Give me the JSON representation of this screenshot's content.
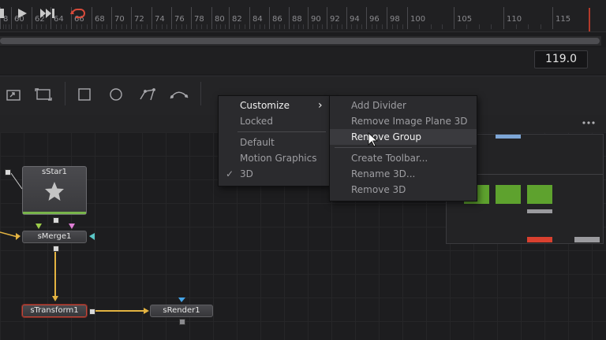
{
  "ruler": {
    "ticks": [
      "8",
      "60",
      "62",
      "64",
      "66",
      "68",
      "70",
      "72",
      "74",
      "76",
      "78",
      "80",
      "82",
      "84",
      "86",
      "88",
      "90",
      "92",
      "94",
      "96",
      "98",
      "100",
      "105",
      "110",
      "115"
    ]
  },
  "transport": {
    "current_frame": "119.0"
  },
  "context_menu": {
    "items": [
      {
        "label": "Customize",
        "has_submenu": true
      },
      {
        "label": "Locked"
      },
      {
        "label": "Default"
      },
      {
        "label": "Motion Graphics"
      },
      {
        "label": "3D",
        "checked": true
      }
    ],
    "check_mark": "✓",
    "submenu_arrow": "›"
  },
  "submenu": {
    "items": [
      {
        "label": "Add Divider"
      },
      {
        "label": "Remove Image Plane 3D"
      },
      {
        "label": "Remove Group",
        "highlighted": true
      },
      {
        "label": "Create Toolbar..."
      },
      {
        "label": "Rename 3D..."
      },
      {
        "label": "Remove 3D"
      }
    ]
  },
  "nodes": {
    "star": "sStar1",
    "merge": "sMerge1",
    "transform": "sTransform1",
    "render": "sRender1"
  },
  "colors": {
    "accent_red": "#c0473a",
    "edge_yellow": "#e3b341",
    "viewer_green": "#5ea22e"
  },
  "icons": {
    "toolbar": [
      "rectangle-mask-icon",
      "transform-icon",
      "rect-icon",
      "ellipse-icon",
      "polygon-icon",
      "bspline-icon"
    ],
    "transport": [
      "stop-icon",
      "play-icon",
      "skip-end-icon",
      "loop-icon"
    ]
  }
}
